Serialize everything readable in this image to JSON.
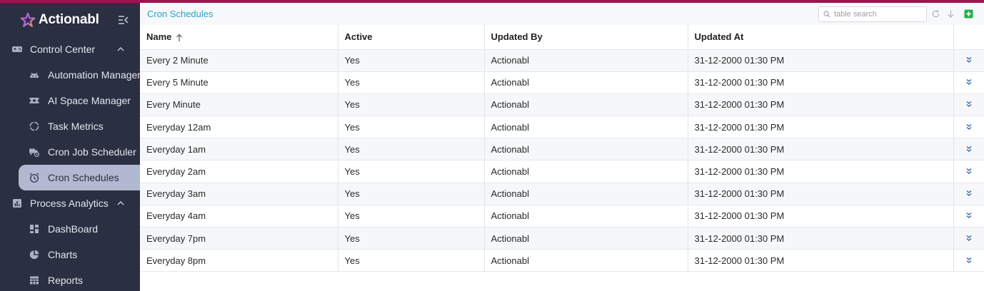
{
  "app": {
    "name": "Actionabl",
    "accent_color": "#a0134f",
    "sidebar_color": "#2b2f42",
    "link_color": "#2ca2c4"
  },
  "sidebar": {
    "groups": [
      {
        "label": "Control Center",
        "icon": "gamepad-icon",
        "expanded": true,
        "items": [
          {
            "label": "Automation Manager",
            "icon": "android-icon"
          },
          {
            "label": "AI Space Manager",
            "icon": "ticket-icon"
          },
          {
            "label": "Task Metrics",
            "icon": "loading-ring-icon"
          },
          {
            "label": "Cron Job Scheduler",
            "icon": "truck-clock-icon"
          },
          {
            "label": "Cron Schedules",
            "icon": "alarm-clock-icon",
            "active": true
          }
        ]
      },
      {
        "label": "Process Analytics",
        "icon": "bar-chart-icon",
        "expanded": true,
        "items": [
          {
            "label": "DashBoard",
            "icon": "dashboard-icon"
          },
          {
            "label": "Charts",
            "icon": "pie-chart-icon"
          },
          {
            "label": "Reports",
            "icon": "table-icon"
          }
        ]
      }
    ]
  },
  "toolbar": {
    "title": "Cron Schedules",
    "search_placeholder": "table search"
  },
  "table": {
    "columns": [
      "Name",
      "Active",
      "Updated By",
      "Updated At"
    ],
    "sorted_column": "Name",
    "sort_direction": "ascending",
    "rows": [
      [
        "Every 2 Minute",
        "Yes",
        "Actionabl",
        "31-12-2000 01:30 PM"
      ],
      [
        "Every 5 Minute",
        "Yes",
        "Actionabl",
        "31-12-2000 01:30 PM"
      ],
      [
        "Every Minute",
        "Yes",
        "Actionabl",
        "31-12-2000 01:30 PM"
      ],
      [
        "Everyday 12am",
        "Yes",
        "Actionabl",
        "31-12-2000 01:30 PM"
      ],
      [
        "Everyday 1am",
        "Yes",
        "Actionabl",
        "31-12-2000 01:30 PM"
      ],
      [
        "Everyday 2am",
        "Yes",
        "Actionabl",
        "31-12-2000 01:30 PM"
      ],
      [
        "Everyday 3am",
        "Yes",
        "Actionabl",
        "31-12-2000 01:30 PM"
      ],
      [
        "Everyday 4am",
        "Yes",
        "Actionabl",
        "31-12-2000 01:30 PM"
      ],
      [
        "Everyday 7pm",
        "Yes",
        "Actionabl",
        "31-12-2000 01:30 PM"
      ],
      [
        "Everyday 8pm",
        "Yes",
        "Actionabl",
        "31-12-2000 01:30 PM"
      ]
    ]
  }
}
